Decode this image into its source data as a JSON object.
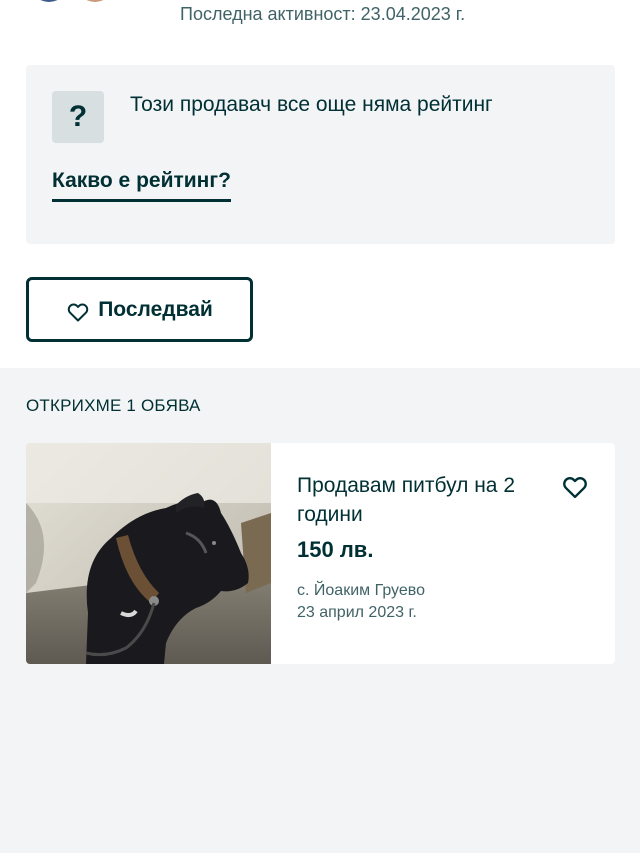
{
  "profile": {
    "last_active": "Последна активност: 23.04.2023 г."
  },
  "rating": {
    "icon_symbol": "?",
    "no_rating_text": "Този продавач все още няма рейтинг",
    "what_is_rating_link": "Какво е рейтинг?"
  },
  "follow": {
    "label": "Последвай",
    "icon": "heart-outline-icon"
  },
  "results": {
    "found_text": "ОТКРИХМЕ 1 ОБЯВА"
  },
  "listings": [
    {
      "title": "Продавам питбул на 2 години",
      "price": "150 лв.",
      "location": "с. Йоаким Груево",
      "date": "23 април 2023 г.",
      "favorite_icon": "heart-outline-icon"
    }
  ],
  "colors": {
    "primary_text": "#002f34",
    "secondary_text": "#406367",
    "page_background": "#f2f4f5",
    "card_background": "#ffffff"
  }
}
